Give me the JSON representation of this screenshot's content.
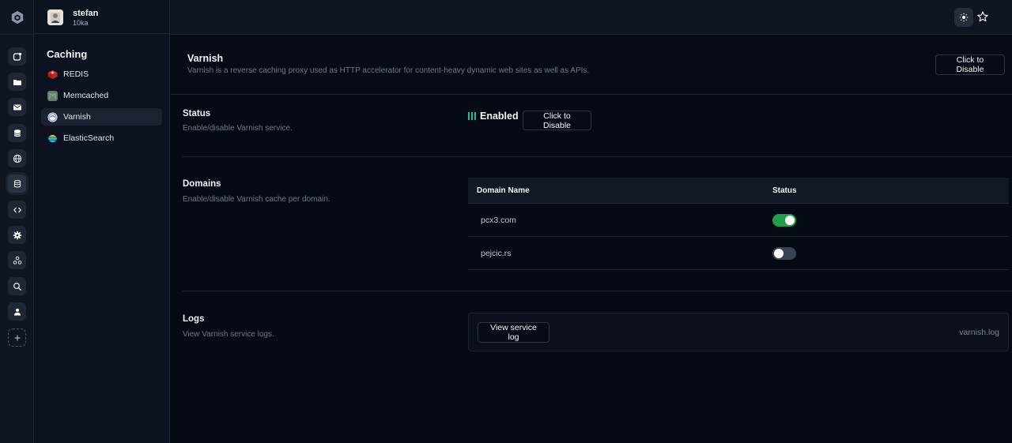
{
  "user": {
    "name": "stefan",
    "org": "10ka"
  },
  "sidebar": {
    "heading": "Caching",
    "items": [
      {
        "label": "REDIS",
        "icon": "redis-icon",
        "color": "#d8312f"
      },
      {
        "label": "Memcached",
        "icon": "memcached-icon",
        "color": "#5e7f69"
      },
      {
        "label": "Varnish",
        "icon": "varnish-icon",
        "color": "#6aa4d8",
        "active": true
      },
      {
        "label": "ElasticSearch",
        "icon": "elasticsearch-icon",
        "color": "#f0bf1a"
      }
    ]
  },
  "rail": {
    "icons": [
      "new-window-icon",
      "folder-icon",
      "mail-icon",
      "database-icon",
      "globe-icon",
      "storage-icon",
      "code-icon",
      "gear-icon",
      "network-icon",
      "search-icon",
      "user-icon",
      "add-icon"
    ],
    "active": "storage-icon"
  },
  "header": {
    "theme_icon": "sun-icon",
    "favorite_icon": "star-icon"
  },
  "page": {
    "title": "Varnish",
    "description": "Varnish is a reverse caching proxy used as HTTP accelerator for content-heavy dynamic web sites as well as APIs.",
    "toggle_button": "Click to Disable"
  },
  "status_section": {
    "title": "Status",
    "description": "Enable/disable Varnish service.",
    "state": "Enabled",
    "button": "Click to Disable",
    "accent": "#1fbf8f"
  },
  "domains_section": {
    "title": "Domains",
    "description": "Enable/disable Varnish cache per domain.",
    "columns": [
      "Domain Name",
      "Status"
    ],
    "rows": [
      {
        "domain": "pcx3.com",
        "enabled": true
      },
      {
        "domain": "pejcic.rs",
        "enabled": false
      }
    ]
  },
  "logs_section": {
    "title": "Logs",
    "description": "View Varnish service logs.",
    "button": "View service log",
    "file": "varnish.log"
  }
}
